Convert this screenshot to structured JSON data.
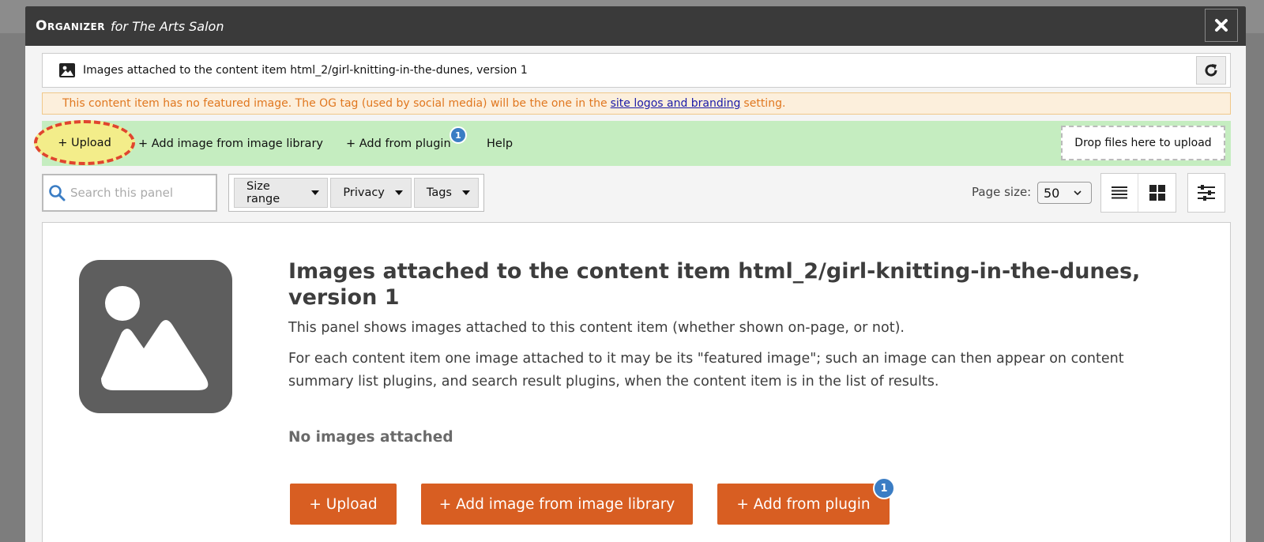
{
  "modal": {
    "title": "Organizer",
    "subtitle": "for The Arts Salon"
  },
  "breadcrumb": {
    "text": "Images attached to the content item html_2/girl-knitting-in-the-dunes, version 1"
  },
  "warning": {
    "before": "This content item has no featured image. The OG tag (used by social media) will be the one in the",
    "link": "site logos and branding",
    "after": "setting."
  },
  "toolbar": {
    "upload": "+ Upload",
    "add_library": "+ Add image from image library",
    "add_plugin": "+ Add from plugin",
    "plugin_badge": "1",
    "help": "Help",
    "dropzone": "Drop files here to upload"
  },
  "filters": {
    "search_placeholder": "Search this panel",
    "size_range": "Size range",
    "privacy": "Privacy",
    "tags": "Tags",
    "page_size_label": "Page size:",
    "page_size_value": "50"
  },
  "panel": {
    "title": "Images attached to the content item html_2/girl-knitting-in-the-dunes, version 1",
    "description": "This panel shows images attached to this content item (whether shown on-page, or not).",
    "description2": "For each content item one image attached to it may be its \"featured image\"; such an image can then appear on content summary list plugins, and search result plugins, when the content item is in the list of results.",
    "empty": "No images attached",
    "btn_upload": "+ Upload",
    "btn_library": "+ Add image from image library",
    "btn_plugin": "+ Add from plugin",
    "btn_plugin_badge": "1"
  },
  "colors": {
    "accent_orange": "#d85e22",
    "toolbar_green": "#c5edc0",
    "badge_blue": "#3b7dc4",
    "highlight_red": "#e0452e"
  }
}
